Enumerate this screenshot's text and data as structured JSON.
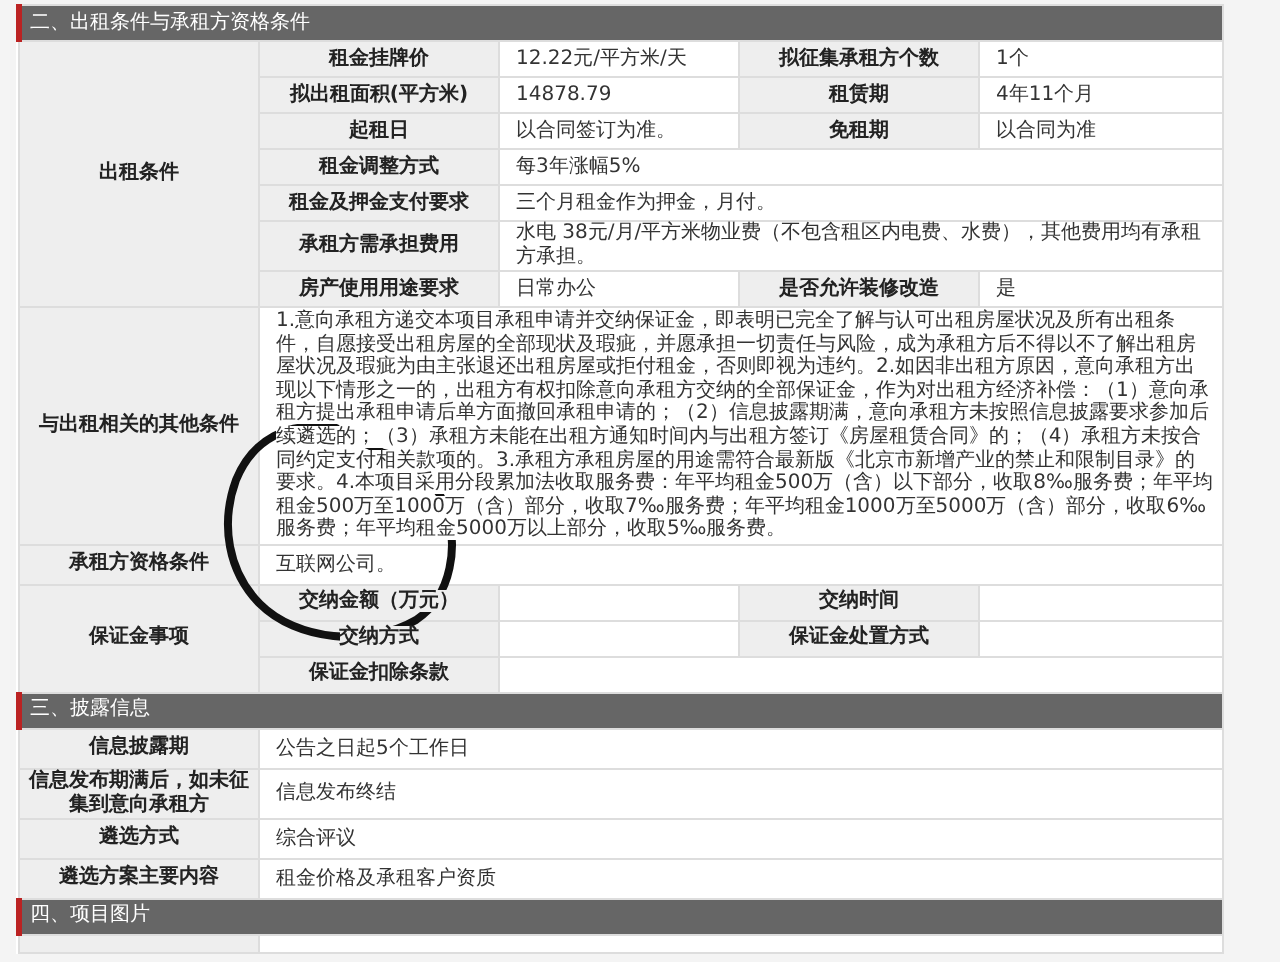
{
  "sections": [
    {
      "title": "二、出租条件与承租方资格条件",
      "blocks": [
        {
          "label": "出租条件",
          "rows": [
            {
              "pairs": [
                {
                  "label": "租金挂牌价",
                  "value": "12.22元/平方米/天"
                },
                {
                  "label": "拟征集承租方个数",
                  "value": "1个"
                }
              ]
            },
            {
              "pairs": [
                {
                  "label": "拟出租面积(平方米)",
                  "value": "14878.79"
                },
                {
                  "label": "租赁期",
                  "value": "4年11个月"
                }
              ]
            },
            {
              "pairs": [
                {
                  "label": "起租日",
                  "value": "以合同签订为准。"
                },
                {
                  "label": "免租期",
                  "value": "以合同为准"
                }
              ]
            },
            {
              "pairs": [
                {
                  "label": "租金调整方式",
                  "value": "每3年涨幅5%"
                }
              ]
            },
            {
              "pairs": [
                {
                  "label": "租金及押金支付要求",
                  "value": "三个月租金作为押金，月付。"
                }
              ]
            },
            {
              "pairs": [
                {
                  "label": "承租方需承担费用",
                  "value": "水电 38元/月/平方米物业费（不包含租区内电费、水费），其他费用均有承租方承担。"
                }
              ]
            },
            {
              "pairs": [
                {
                  "label": "房产使用用途要求",
                  "value": "日常办公"
                },
                {
                  "label": "是否允许装修改造",
                  "value": "是"
                }
              ]
            }
          ]
        },
        {
          "label": "与出租相关的其他条件",
          "text": "1.意向承租方递交本项目承租申请并交纳保证金，即表明已完全了解与认可出租房屋状况及所有出租条件，自愿接受出租房屋的全部现状及瑕疵，并愿承担一切责任与风险，成为承租方后不得以不了解出租房屋状况及瑕疵为由主张退还出租房屋或拒付租金，否则即视为违约。2.如因非出租方原因，意向承租方出现以下情形之一的，出租方有权扣除意向承租方交纳的全部保证金，作为对出租方经济补偿：（1）意向承租方提出承租申请后单方面撤回承租申请的；（2）信息披露期满，意向承租方未按照信息披露要求参加后续遴选的；（3）承租方未能在出租方通知时间内与出租方签订《房屋租赁合同》的；（4）承租方未按合同约定支付相关款项的。3.承租方承租房屋的用途需符合最新版《北京市新增产业的禁止和限制目录》的要求。4.本项目采用分段累加法收取服务费：年平均租金500万（含）以下部分，收取8‰服务费；年平均租金500万至1000万（含）部分，收取7‰服务费；年平均租金1000万至5000万（含）部分，收取6‰服务费；年平均租金5000万以上部分，收取5‰服务费。"
        },
        {
          "label": "承租方资格条件",
          "text": "互联网公司。"
        },
        {
          "label": "保证金事项",
          "rows": [
            {
              "pairs": [
                {
                  "label": "交纳金额（万元）"
                },
                {
                  "label": "交纳时间"
                }
              ]
            },
            {
              "pairs": [
                {
                  "label": "交纳方式"
                },
                {
                  "label": "保证金处置方式"
                }
              ]
            },
            {
              "pairs": [
                {
                  "label": "保证金扣除条款"
                }
              ]
            }
          ]
        }
      ]
    },
    {
      "title": "三、披露信息",
      "blocks": [
        {
          "label": "信息披露期",
          "text": "公告之日起5个工作日"
        },
        {
          "label": "信息发布期满后，如未征集到意向承租方",
          "text": "信息发布终结"
        },
        {
          "label": "遴选方式",
          "text": "综合评议"
        },
        {
          "label": "遴选方案主要内容",
          "text": "租金价格及承租客户资质"
        }
      ]
    },
    {
      "title": "四、项目图片"
    }
  ]
}
